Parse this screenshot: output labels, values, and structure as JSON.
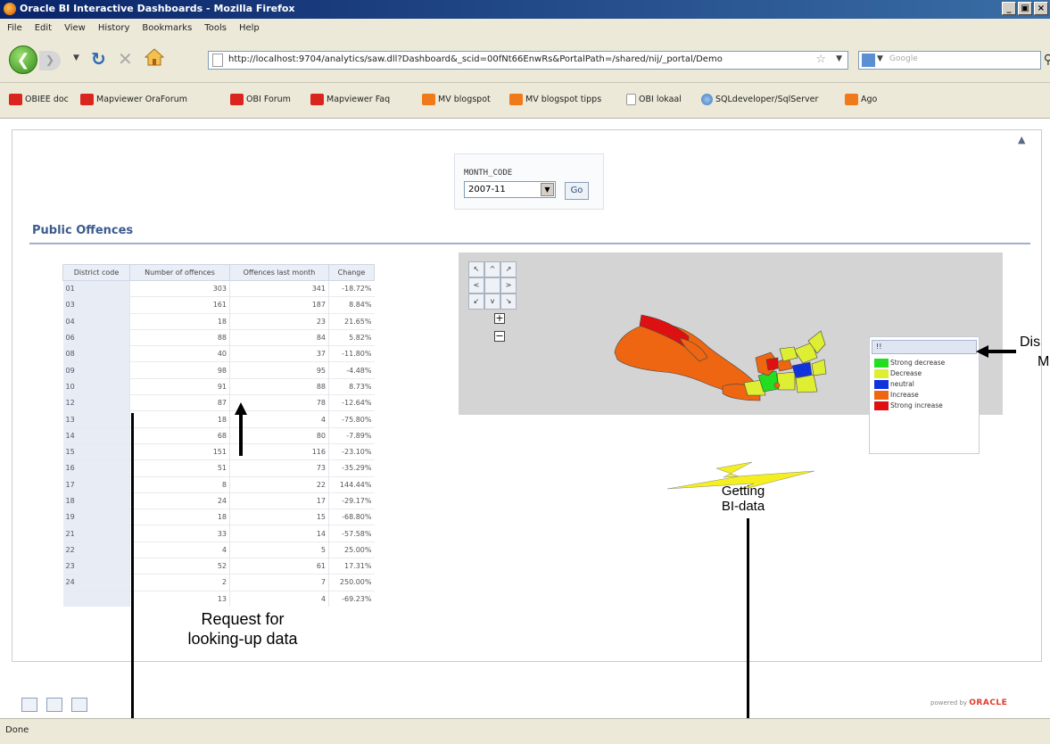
{
  "window": {
    "title": "Oracle BI Interactive Dashboards - Mozilla Firefox",
    "buttons": [
      "_",
      "▣",
      "×"
    ]
  },
  "menu": [
    "File",
    "Edit",
    "View",
    "History",
    "Bookmarks",
    "Tools",
    "Help"
  ],
  "nav": {
    "url": "http://localhost:9704/analytics/saw.dll?Dashboard&_scid=00fNt66EnwRs&PortalPath=/shared/nij/_portal/Demo",
    "search_engine": "Google"
  },
  "bookmarks": [
    {
      "label": "OBIEE doc",
      "icon": "red"
    },
    {
      "label": "Mapviewer OraForum",
      "icon": "red"
    },
    {
      "label": "OBI Forum",
      "icon": "red"
    },
    {
      "label": "Mapviewer Faq",
      "icon": "red"
    },
    {
      "label": "MV blogspot",
      "icon": "orange"
    },
    {
      "label": "MV blogspot tipps",
      "icon": "orange"
    },
    {
      "label": "OBI lokaal",
      "icon": "page"
    },
    {
      "label": "SQLdeveloper/SqlServer",
      "icon": "globe"
    },
    {
      "label": "Ago",
      "icon": "orange"
    }
  ],
  "prompt": {
    "label": "MONTH_CODE",
    "selected": "2007-11",
    "go": "Go"
  },
  "section_title": "Public Offences",
  "table": {
    "columns": [
      "District code",
      "Number of offences",
      "Offences last month",
      "Change"
    ],
    "rows": [
      [
        "01",
        "303",
        "341",
        "-18.72%"
      ],
      [
        "03",
        "161",
        "187",
        "8.84%"
      ],
      [
        "04",
        "18",
        "23",
        "21.65%"
      ],
      [
        "06",
        "88",
        "84",
        "5.82%"
      ],
      [
        "08",
        "40",
        "37",
        "-11.80%"
      ],
      [
        "09",
        "98",
        "95",
        "-4.48%"
      ],
      [
        "10",
        "91",
        "88",
        "8.73%"
      ],
      [
        "12",
        "87",
        "78",
        "-12.64%"
      ],
      [
        "13",
        "18",
        "4",
        "-75.80%"
      ],
      [
        "14",
        "68",
        "80",
        "-7.89%"
      ],
      [
        "15",
        "151",
        "116",
        "-23.10%"
      ],
      [
        "16",
        "51",
        "73",
        "-35.29%"
      ],
      [
        "17",
        "8",
        "22",
        "144.44%"
      ],
      [
        "18",
        "24",
        "17",
        "-29.17%"
      ],
      [
        "19",
        "18",
        "15",
        "-68.80%"
      ],
      [
        "21",
        "33",
        "14",
        "-57.58%"
      ],
      [
        "22",
        "4",
        "5",
        "25.00%"
      ],
      [
        "23",
        "52",
        "61",
        "17.31%"
      ],
      [
        "24",
        "2",
        "7",
        "250.00%"
      ],
      [
        "",
        "13",
        "4",
        "-69.23%"
      ]
    ]
  },
  "map": {
    "pan_labels": [
      "↖",
      "^",
      "↗",
      "<",
      "",
      ">",
      "↙",
      "v",
      "↘"
    ],
    "zoom_in": "+",
    "zoom_out": "−",
    "legend": {
      "header": "!!",
      "items": [
        {
          "label": "Strong decrease",
          "color": "#22dd22"
        },
        {
          "label": "Decrease",
          "color": "#ddee33"
        },
        {
          "label": "neutral",
          "color": "#1133dd"
        },
        {
          "label": "Increase",
          "color": "#ee6611"
        },
        {
          "label": "Strong increase",
          "color": "#dd1111"
        }
      ]
    }
  },
  "annotations": {
    "getting_line1": "Getting",
    "getting_line2": "BI-data",
    "request_line1": "Request for",
    "request_line2": "looking-up data",
    "legend_note_line1": "Dis",
    "legend_note_line2": "M"
  },
  "footer": {
    "powered": "powered by",
    "brand": "ORACLE"
  },
  "status": {
    "text": "Done"
  }
}
